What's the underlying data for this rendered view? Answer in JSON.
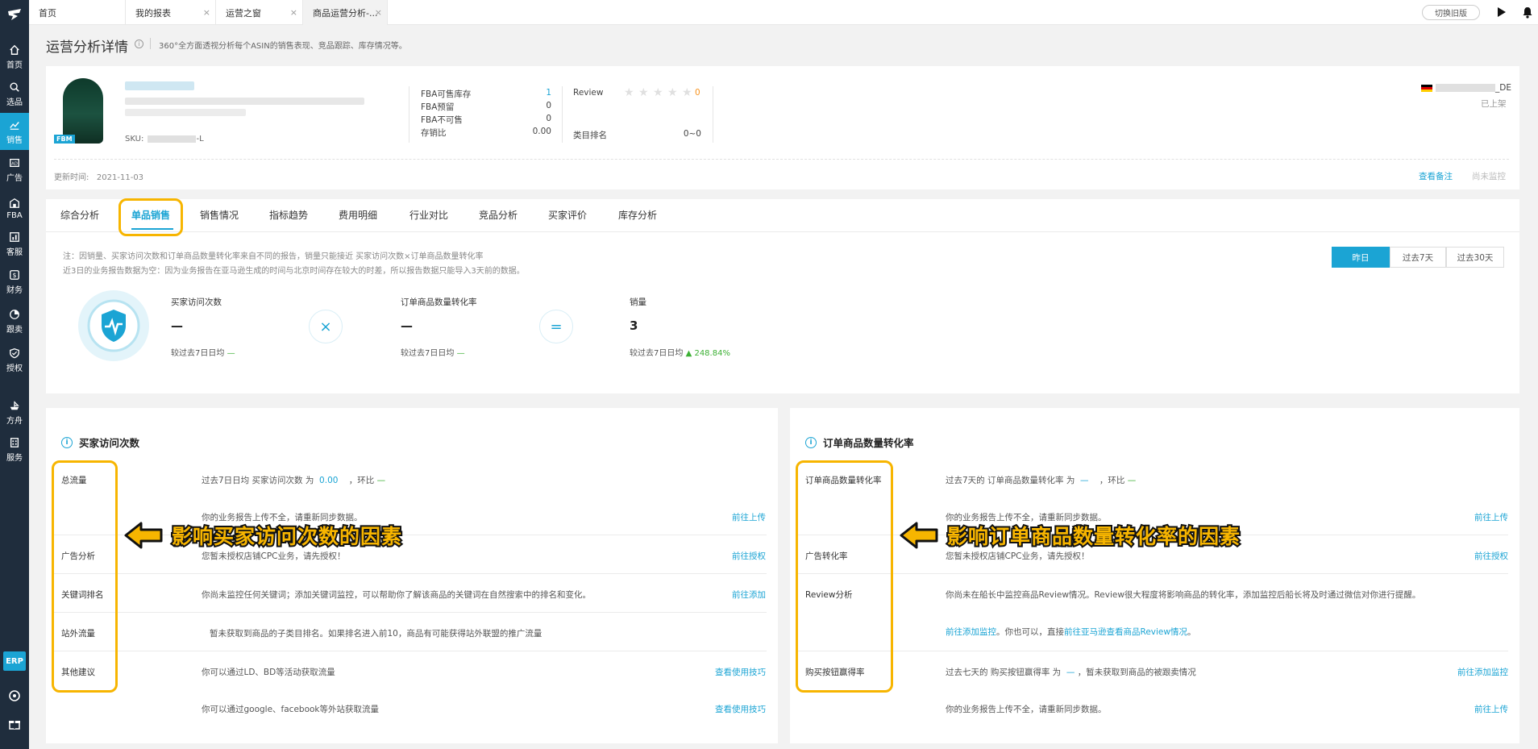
{
  "sidebar": {
    "items": [
      {
        "label": "首页",
        "icon": "home-icon"
      },
      {
        "label": "选品",
        "icon": "search-icon"
      },
      {
        "label": "销售",
        "icon": "chart-icon",
        "active": true
      },
      {
        "label": "广告",
        "icon": "ad-icon"
      },
      {
        "label": "FBA",
        "icon": "warehouse-icon"
      },
      {
        "label": "客服",
        "icon": "service-icon"
      },
      {
        "label": "财务",
        "icon": "finance-icon"
      },
      {
        "label": "跟卖",
        "icon": "pie-icon"
      },
      {
        "label": "授权",
        "icon": "shield-icon"
      },
      {
        "label": "方舟",
        "icon": "ark-icon"
      },
      {
        "label": "服务",
        "icon": "building-icon"
      }
    ],
    "erp": "ERP"
  },
  "tabs": [
    {
      "label": "首页",
      "closable": false
    },
    {
      "label": "我的报表",
      "closable": true
    },
    {
      "label": "运营之窗",
      "closable": true
    },
    {
      "label": "商品运营分析-...",
      "closable": true,
      "active": true
    }
  ],
  "topbar": {
    "switch_label": "切换旧版"
  },
  "page": {
    "title": "运营分析详情",
    "desc": "360°全方面透视分析每个ASIN的销售表现、竞品跟踪、库存情况等。"
  },
  "product": {
    "badge": "FBM",
    "sku_label": "SKU:",
    "sku_suffix": "-L",
    "fba": [
      {
        "label": "FBA可售库存",
        "value": "1",
        "link": true
      },
      {
        "label": "FBA预留",
        "value": "0"
      },
      {
        "label": "FBA不可售",
        "value": "0"
      },
      {
        "label": "存销比",
        "value": "0.00"
      }
    ],
    "review_label": "Review",
    "review_count": "0",
    "review_rating": 0,
    "category_label": "类目排名",
    "category_value": "0~0",
    "country_suffix": "_DE",
    "status": "已上架",
    "update_label": "更新时间:",
    "update_value": "2021-11-03",
    "view_notes": "查看备注",
    "not_monitored": "尚未监控"
  },
  "nav_tabs": [
    "综合分析",
    "单品销售",
    "销售情况",
    "指标趋势",
    "费用明细",
    "行业对比",
    "竞品分析",
    "买家评价",
    "库存分析"
  ],
  "nav_active": 1,
  "notes": {
    "line1": "注：因销量、买家访问次数和订单商品数量转化率来自不同的报告，销量只能接近 买家访问次数×订单商品数量转化率",
    "line2": "近3日的业务报告数据为空：因为业务报告在亚马逊生成的时间与北京时间存在较大的时差，所以报告数据只能导入3天前的数据。"
  },
  "periods": [
    "昨日",
    "过去7天",
    "过去30天"
  ],
  "period_active": 0,
  "metrics": [
    {
      "label": "买家访问次数",
      "value": "—",
      "cmp_label": "较过去7日日均",
      "cmp_value": "—"
    },
    {
      "label": "订单商品数量转化率",
      "value": "—",
      "cmp_label": "较过去7日日均",
      "cmp_value": "—"
    },
    {
      "label": "销量",
      "value": "3",
      "cmp_label": "较过去7日日均",
      "cmp_value": "248.84%",
      "trend": "up"
    }
  ],
  "operators": {
    "times": "×",
    "equals": "="
  },
  "left_section": {
    "title": "买家访问次数",
    "rows": [
      {
        "label": "总流量",
        "text_pre": "过去7日日均 买家访问次数 为",
        "value": "0.00",
        "text_mid": "，环比",
        "change": "—"
      },
      {
        "text": "你的业务报告上传不全，请重新同步数据。",
        "action": "前往上传"
      },
      {
        "label": "广告分析",
        "text": "您暂未授权店铺CPC业务，请先授权！",
        "action": "前往授权"
      },
      {
        "label": "关键词排名",
        "text": "你尚未监控任何关键词；添加关键词监控，可以帮助你了解该商品的关键词在自然搜索中的排名和变化。",
        "action": "前往添加"
      },
      {
        "label": "站外流量",
        "text": "暂未获取到商品的子类目排名。如果排名进入前10，商品有可能获得站外联盟的推广流量"
      },
      {
        "label": "其他建议",
        "text": "你可以通过LD、BD等活动获取流量",
        "action": "查看使用技巧"
      },
      {
        "text": "你可以通过google、facebook等外站获取流量",
        "action": "查看使用技巧"
      }
    ],
    "annotation": "影响买家访问次数的因素"
  },
  "right_section": {
    "title": "订单商品数量转化率",
    "rows": [
      {
        "label": "订单商品数量转化率",
        "text_pre": "过去7天的 订单商品数量转化率 为",
        "value": "—",
        "text_mid": "，环比",
        "change": "—"
      },
      {
        "text": "你的业务报告上传不全，请重新同步数据。",
        "action": "前往上传"
      },
      {
        "label": "广告转化率",
        "text": "您暂未授权店铺CPC业务，请先授权！",
        "action": "前往授权"
      },
      {
        "label": "Review分析",
        "text": "你尚未在船长中监控商品Review情况。Review很大程度将影响商品的转化率，添加监控后船长将及时通过微信对你进行提醒。"
      },
      {
        "link1": "前往添加监控",
        "text_mid": "。你也可以，直接",
        "link2": "前往亚马逊查看商品Review情况",
        "text_end": "。"
      },
      {
        "label": "购买按钮赢得率",
        "text_pre": "过去七天的 购买按钮赢得率 为",
        "value": "—",
        "text_mid": "，暂未获取到商品的被跟卖情况",
        "action": "前往添加监控"
      },
      {
        "text": "你的业务报告上传不全，请重新同步数据。",
        "action": "前往上传"
      }
    ],
    "annotation": "影响订单商品数量转化率的因素"
  },
  "colors": {
    "accent": "#1ba4d4",
    "highlight": "#f7b500",
    "positive": "#3cb034",
    "sidebar": "#1f2d3d"
  }
}
